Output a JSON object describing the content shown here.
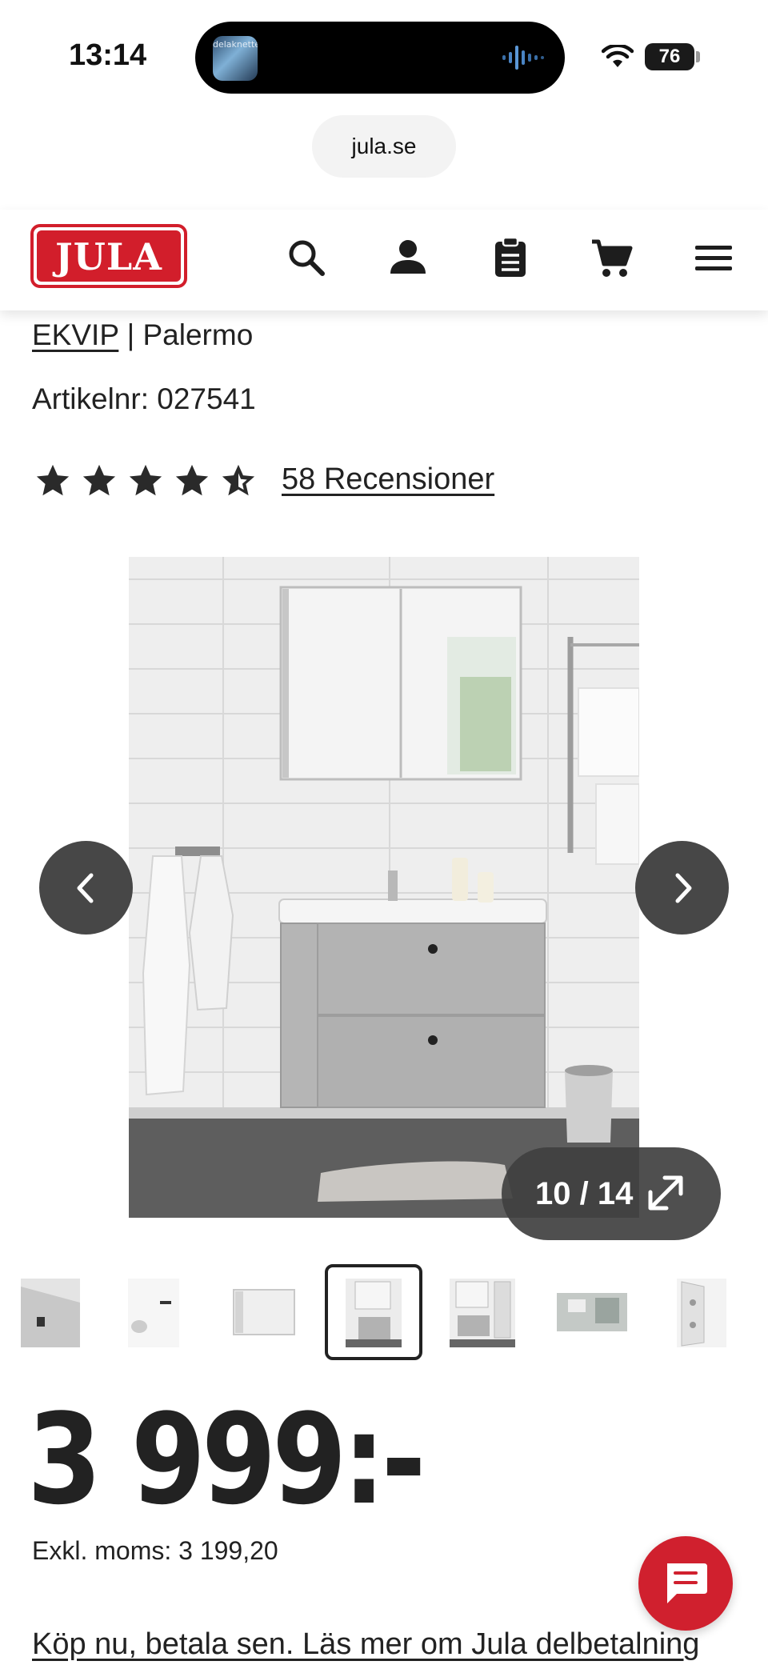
{
  "status_bar": {
    "time": "13:14",
    "battery": "76",
    "island_art_text": "delaknette"
  },
  "browser": {
    "url": "jula.se"
  },
  "header": {
    "logo_text": "JULA",
    "icons": [
      "search-icon",
      "account-icon",
      "clipboard-icon",
      "cart-icon",
      "menu-icon"
    ],
    "brand_color": "#d21e2b"
  },
  "product": {
    "brand": "EKVIP",
    "separator": " | ",
    "name": "Palermo",
    "article_label": "Artikelnr: 027541",
    "rating": 4.5,
    "reviews_label": "58 Recensioner"
  },
  "gallery": {
    "counter": "10 / 14",
    "current_index": 10,
    "total": 14
  },
  "price": {
    "value": "3 999:-",
    "vat_label": "Exkl. moms: 3 199,20",
    "pay_later_label": "Köp nu, betala sen. Läs mer om Jula delbetalning"
  },
  "chat": {
    "icon": "chat-icon",
    "color": "#d0202e"
  }
}
